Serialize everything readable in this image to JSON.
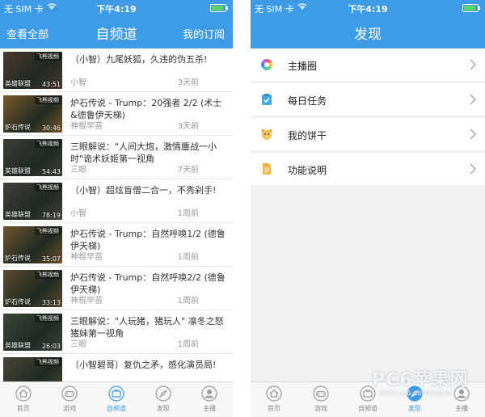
{
  "colors": {
    "brand_blue": "#3d9be8",
    "battery_green": "#5ed35e",
    "text_dark": "#333333",
    "text_gray": "#999999"
  },
  "status_bar": {
    "carrier": "无 SIM 卡",
    "time": "下午4:19",
    "battery_level": 0.85
  },
  "left_screen": {
    "nav": {
      "left_button": "查看全部",
      "title": "自频道",
      "right_button": "我的订阅"
    },
    "videos": [
      {
        "title": "（小智）九尾妖狐，久违的伪五杀!",
        "author": "小智",
        "time": "3天前",
        "duration": "43:51",
        "corner_tag": "飞熊视频",
        "game_tag": "英雄联盟",
        "thumb_color": "#4a3a2f"
      },
      {
        "title": "炉石传说 - Trump：20强者 2/2 (术士&德鲁伊天梯)",
        "author": "神棍早苗",
        "time": "3天前",
        "duration": "30:46",
        "corner_tag": "飞熊视频",
        "game_tag": "炉石传说",
        "thumb_color": "#7a5a2c"
      },
      {
        "title": "三眼解说：\"人间大炮，激情鏖战一小时\"诡术妖姬第一视角",
        "author": "三眼",
        "time": "7天前",
        "duration": "54:43",
        "corner_tag": "飞熊视频",
        "game_tag": "英雄联盟",
        "thumb_color": "#3a3f35"
      },
      {
        "title": "（小智）超炫盲僧二合一，不秀剁手!",
        "author": "小智",
        "time": "1周前",
        "duration": "78:19",
        "corner_tag": "飞熊视频",
        "game_tag": "英雄联盟",
        "thumb_color": "#45403a"
      },
      {
        "title": "炉石传说 - Trump：自然呼唤1/2 (德鲁伊天梯)",
        "author": "神棍早苗",
        "time": "1周前",
        "duration": "35:07",
        "corner_tag": "飞熊视频",
        "game_tag": "炉石传说",
        "thumb_color": "#6e5530"
      },
      {
        "title": "炉石传说 - Trump：自然呼唤2/2 (德鲁伊天梯)",
        "author": "神棍早苗",
        "time": "1周前",
        "duration": "33:13",
        "corner_tag": "飞熊视频",
        "game_tag": "炉石传说",
        "thumb_color": "#5d4a2e"
      },
      {
        "title": "三眼解说：\"人玩猪，猪玩人\" 凛冬之怒猪妹第一视角",
        "author": "三眼",
        "time": "1周前",
        "duration": "26:03",
        "corner_tag": "飞熊视频",
        "game_tag": "英雄联盟",
        "thumb_color": "#3c4638"
      },
      {
        "title": "（小智碧哥）复仇之矛，感化演员局!",
        "author": "",
        "time": "",
        "duration": "",
        "corner_tag": "飞熊视频",
        "game_tag": "",
        "thumb_color": "#4a4436"
      }
    ],
    "tabs": [
      {
        "label": "首页",
        "icon": "home-icon",
        "active": false
      },
      {
        "label": "游戏",
        "icon": "gamepad-icon",
        "active": false
      },
      {
        "label": "自频道",
        "icon": "tv-icon",
        "active": true
      },
      {
        "label": "发现",
        "icon": "compass-icon",
        "active": false
      },
      {
        "label": "主播",
        "icon": "user-icon",
        "active": false
      }
    ]
  },
  "right_screen": {
    "nav": {
      "title": "发现"
    },
    "menu": [
      {
        "label": "主播圈",
        "icon": "color-wheel-icon"
      },
      {
        "label": "每日任务",
        "icon": "clipboard-check-icon"
      },
      {
        "label": "我的饼干",
        "icon": "bear-icon"
      },
      {
        "label": "功能说明",
        "icon": "document-icon"
      }
    ],
    "tabs": [
      {
        "label": "首页",
        "icon": "home-icon",
        "active": false
      },
      {
        "label": "游戏",
        "icon": "gamepad-icon",
        "active": false
      },
      {
        "label": "自频道",
        "icon": "tv-icon",
        "active": false
      },
      {
        "label": "发现",
        "icon": "compass-icon",
        "active": true
      },
      {
        "label": "主播",
        "icon": "user-icon",
        "active": false
      }
    ]
  },
  "watermark": {
    "text": "PC6苹果网",
    "url": "www.pc6.com/apple"
  }
}
